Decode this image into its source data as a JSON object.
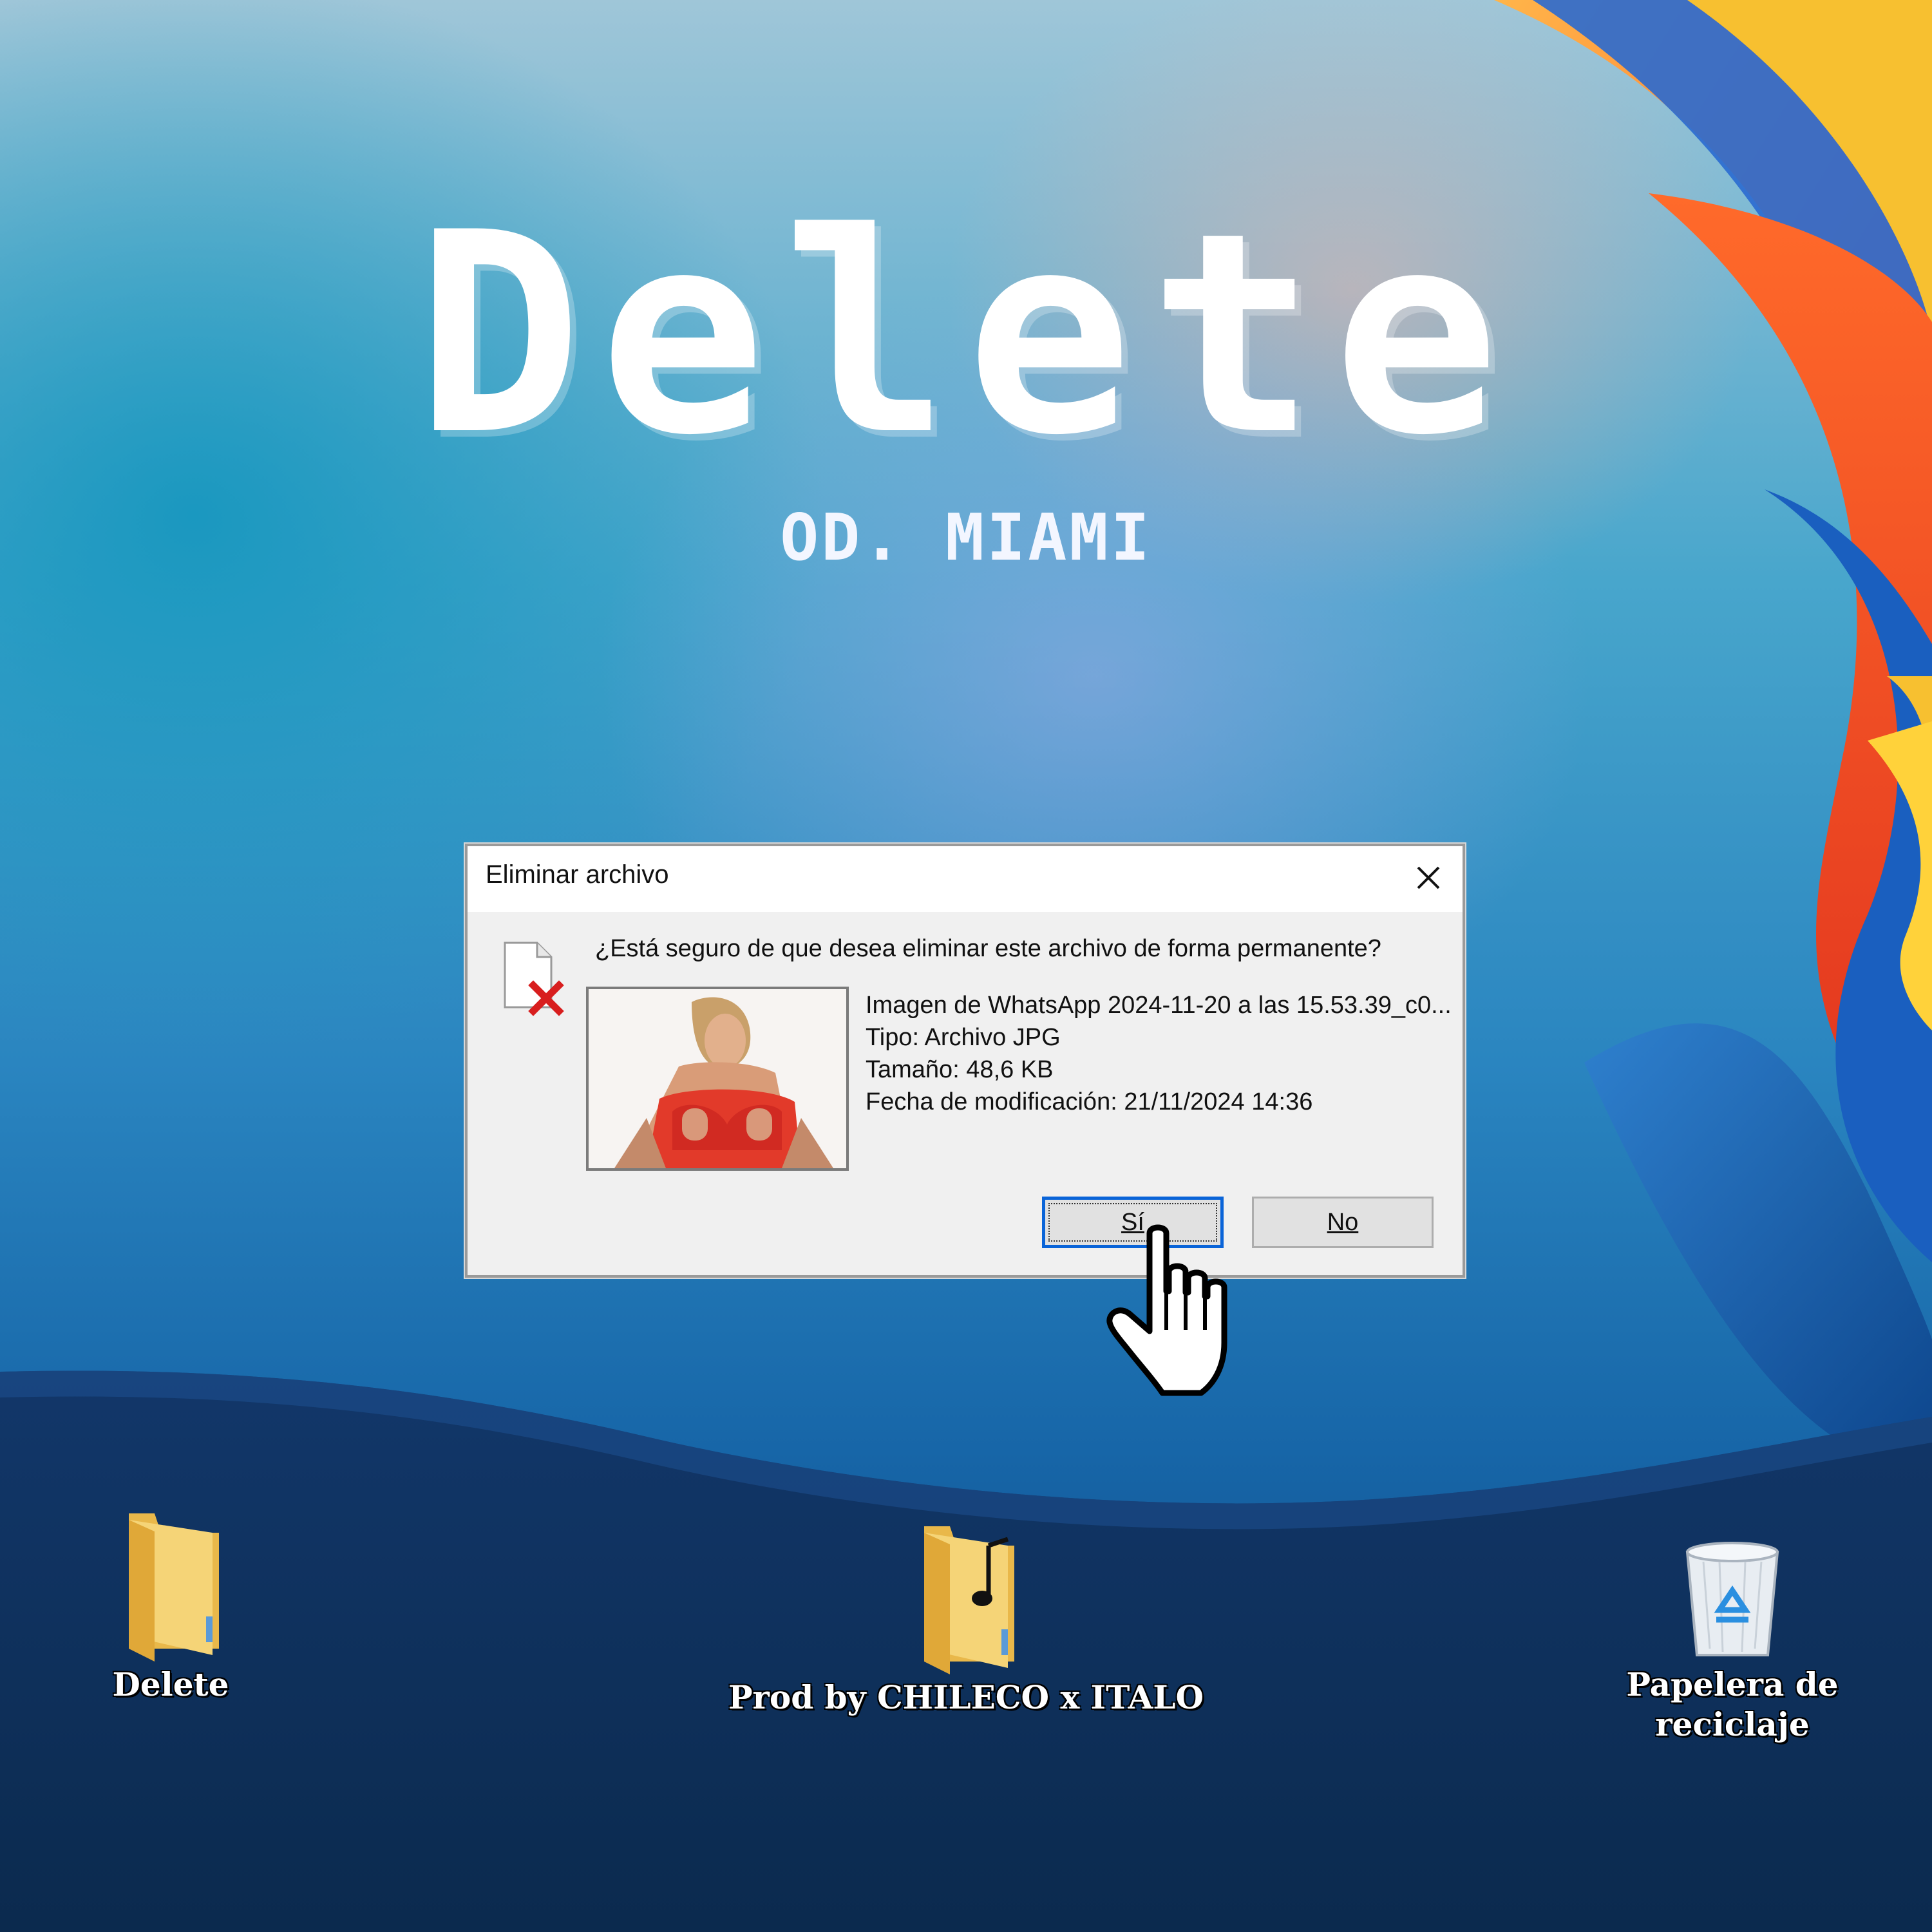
{
  "wallpaper": {
    "title": "Delete",
    "subtitle": "OD. MIAMI"
  },
  "dialog": {
    "title": "Eliminar archivo",
    "close_icon": "close-icon",
    "question": "¿Está seguro de que desea eliminar este archivo de forma permanente?",
    "file": {
      "name": "Imagen de WhatsApp 2024-11-20 a las 15.53.39_c0...",
      "type": "Tipo: Archivo JPG",
      "size": "Tamaño: 48,6 KB",
      "modified": "Fecha de modificación: 21/11/2024 14:36"
    },
    "buttons": {
      "yes": "Sí",
      "no": "No"
    },
    "colors": {
      "focus": "#0a64d8",
      "delete_x": "#d81e1e"
    }
  },
  "desktop_icons": [
    {
      "label": "Delete",
      "icon": "folder-icon"
    },
    {
      "label": "Prod by CHILECO x ITALO",
      "icon": "music-folder-icon"
    },
    {
      "label": "Papelera de reciclaje",
      "icon": "recycle-bin-icon"
    }
  ]
}
